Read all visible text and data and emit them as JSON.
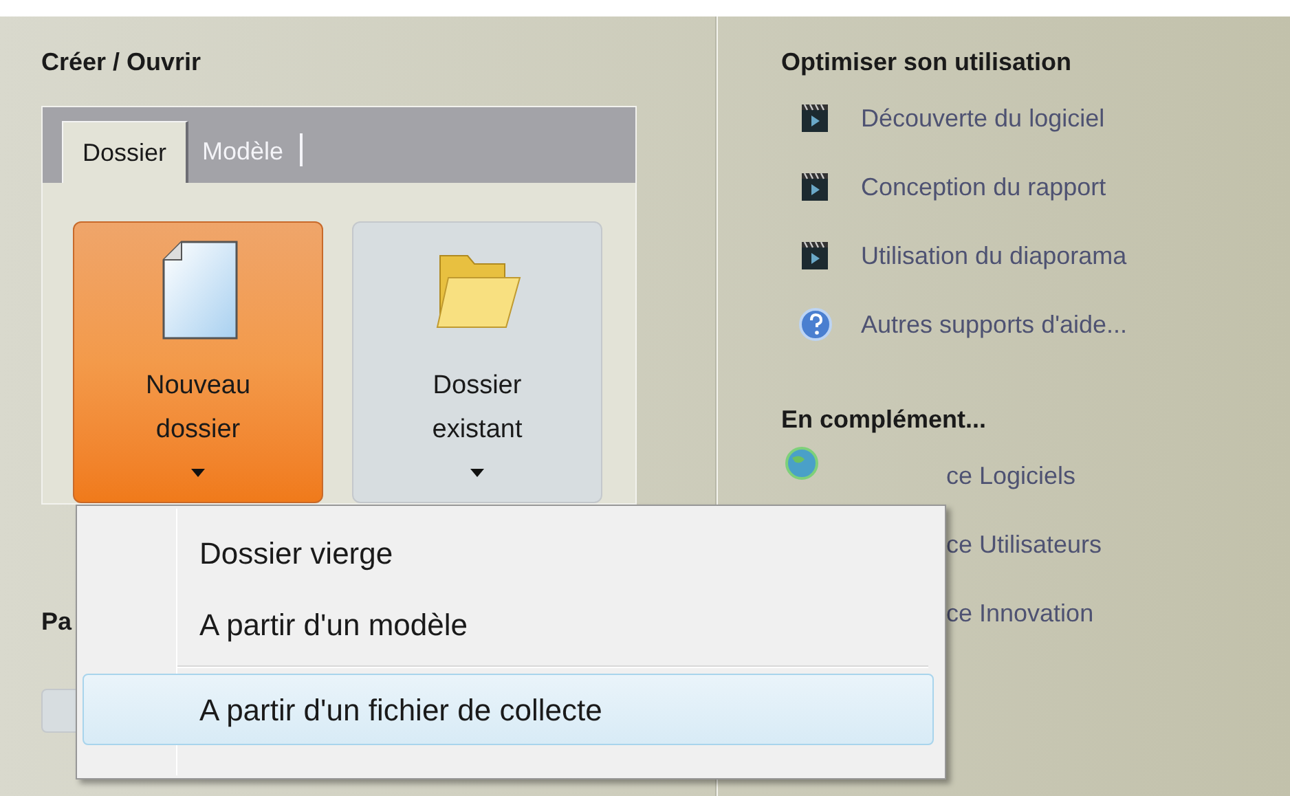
{
  "create_open": {
    "title": "Créer / Ouvrir",
    "tabs": [
      {
        "label": "Dossier",
        "selected": true
      },
      {
        "label": "Modèle",
        "selected": false
      }
    ],
    "buttons": [
      {
        "label": "Nouveau dossier",
        "kind": "new",
        "selected": true
      },
      {
        "label": "Dossier existant",
        "kind": "folder",
        "selected": false
      }
    ]
  },
  "section_2": {
    "title": "Pa"
  },
  "optimize": {
    "title": "Optimiser son utilisation",
    "items": [
      {
        "label": "Découverte du logiciel",
        "kind": "video"
      },
      {
        "label": "Conception du rapport",
        "kind": "video"
      },
      {
        "label": "Utilisation du diaporama",
        "kind": "video"
      },
      {
        "label": "Autres supports d'aide...",
        "kind": "help"
      }
    ]
  },
  "complement": {
    "title": "En complément...",
    "items": [
      {
        "label": "ce Logiciels",
        "kind": "globe"
      },
      {
        "label": "ce Utilisateurs",
        "kind": "text"
      },
      {
        "label": "ce Innovation",
        "kind": "text"
      }
    ]
  },
  "menu": {
    "items": [
      {
        "label": "Dossier vierge",
        "selected": false
      },
      {
        "label": "A partir d'un modèle",
        "selected": false
      },
      {
        "label": "A partir d'un fichier de collecte",
        "selected": true,
        "separator_before": true
      }
    ]
  }
}
